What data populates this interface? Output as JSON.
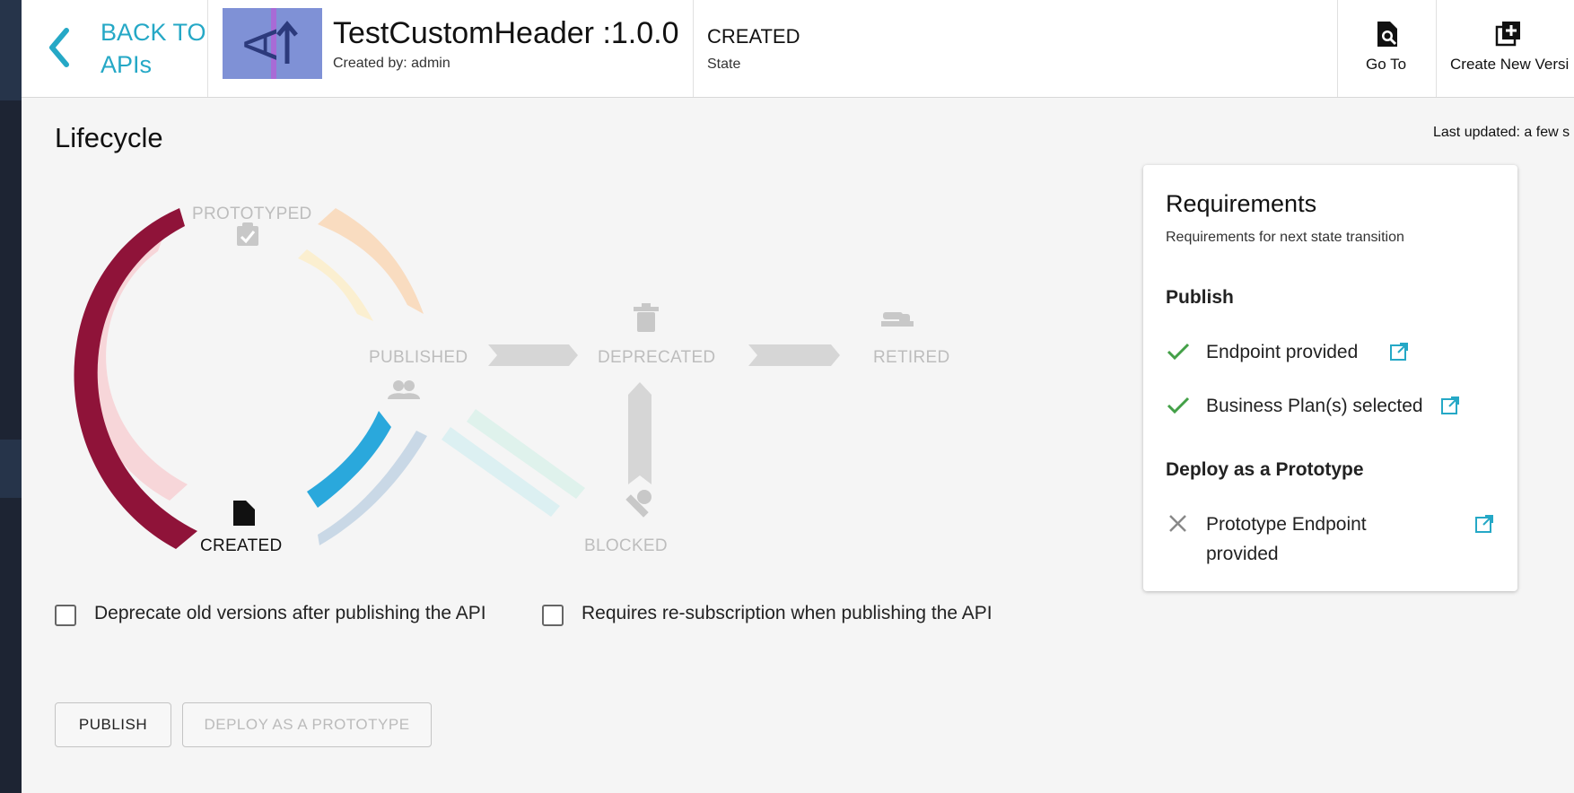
{
  "header": {
    "back_label_line1": "BACK TO",
    "back_label_line2": "APIs",
    "api_title": "TestCustomHeader :1.0.0",
    "created_by": "Created by: admin",
    "state_value": "CREATED",
    "state_label": "State",
    "go_to_label": "Go To",
    "create_new_version_label": "Create New Versi"
  },
  "page": {
    "title": "Lifecycle",
    "last_updated": "Last updated: a few s"
  },
  "lifecycle": {
    "current_state": "CREATED",
    "states": {
      "prototyped": "PROTOTYPED",
      "published": "PUBLISHED",
      "deprecated": "DEPRECATED",
      "retired": "RETIRED",
      "created": "CREATED",
      "blocked": "BLOCKED"
    },
    "colors": {
      "created_to_published_active": "#8f1339",
      "created_to_prototyped_active": "#2aa8dc",
      "inactive": "#d6d6d6"
    }
  },
  "requirements": {
    "title": "Requirements",
    "subtitle": "Requirements for next state transition",
    "sections": [
      {
        "name": "Publish",
        "items": [
          {
            "text": "Endpoint provided",
            "status": "met",
            "icon": "check-icon"
          },
          {
            "text": "Business Plan(s) selected",
            "status": "met",
            "icon": "check-icon"
          }
        ]
      },
      {
        "name": "Deploy as a Prototype",
        "items": [
          {
            "text_line1": "Prototype Endpoint",
            "text_line2": "provided",
            "status": "unmet",
            "icon": "cross-icon"
          }
        ]
      }
    ]
  },
  "options": {
    "deprecate_old": "Deprecate old versions after publishing the API",
    "require_resubscription": "Requires re-subscription when publishing the API"
  },
  "actions": {
    "publish": "PUBLISH",
    "deploy_prototype": "DEPLOY AS A PROTOTYPE"
  }
}
